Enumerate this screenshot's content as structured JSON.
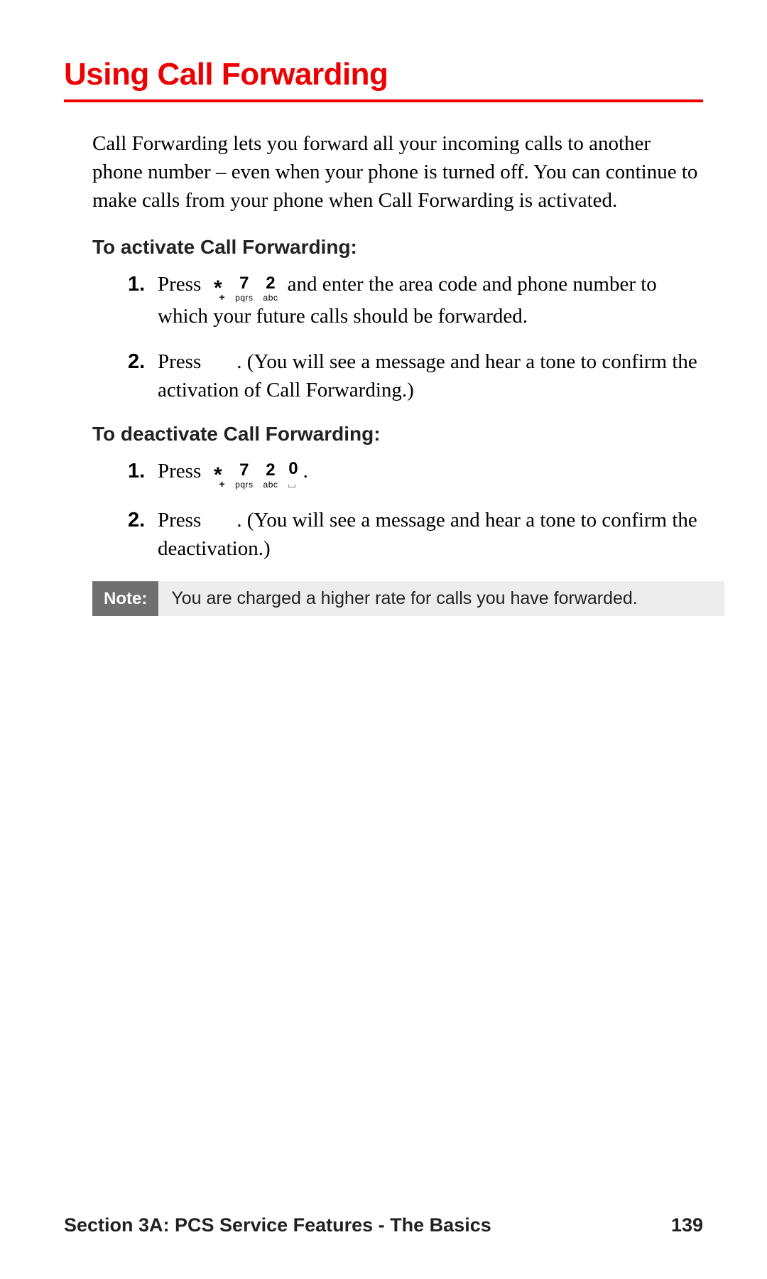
{
  "title": "Using Call Forwarding",
  "intro": "Call Forwarding lets you forward all your incoming calls to another phone number – even when your phone is turned off. You can continue to make calls from your phone when Call Forwarding is activated.",
  "activate": {
    "heading": "To activate Call Forwarding:",
    "steps": [
      {
        "num": "1.",
        "pre": "Press",
        "keys": [
          {
            "top": "*",
            "bot": "+",
            "cls": "star"
          },
          {
            "top": "7",
            "bot": "pqrs",
            "cls": ""
          },
          {
            "top": "2",
            "bot": "abc",
            "cls": ""
          }
        ],
        "post": " and enter the area code and phone number to which your future calls should be forwarded."
      },
      {
        "num": "2.",
        "pre": "Press",
        "keys": [],
        "post": ". (You will see a message and hear a tone to confirm the activation of Call Forwarding.)"
      }
    ]
  },
  "deactivate": {
    "heading": "To deactivate Call Forwarding:",
    "steps": [
      {
        "num": "1.",
        "pre": "Press",
        "keys": [
          {
            "top": "*",
            "bot": "+",
            "cls": "star"
          },
          {
            "top": "7",
            "bot": "pqrs",
            "cls": ""
          },
          {
            "top": "2",
            "bot": "abc",
            "cls": ""
          },
          {
            "top": "0",
            "bot": "⌴",
            "cls": "zero"
          }
        ],
        "post": "."
      },
      {
        "num": "2.",
        "pre": "Press",
        "keys": [],
        "post": ". (You will see a message and hear a tone to confirm the deactivation.)"
      }
    ]
  },
  "note": {
    "label": "Note:",
    "text": "You are charged a higher rate for calls you have forwarded."
  },
  "footer": {
    "section": "Section 3A: PCS Service Features - The Basics",
    "page": "139"
  }
}
